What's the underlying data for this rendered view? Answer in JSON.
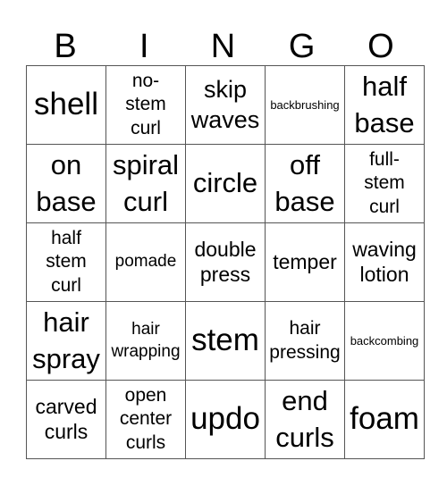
{
  "header": [
    "B",
    "I",
    "N",
    "G",
    "O"
  ],
  "cells": [
    [
      "shell",
      "no-\nstem\ncurl",
      "skip\nwaves",
      "backbrushing",
      "half\nbase"
    ],
    [
      "on\nbase",
      "spiral\ncurl",
      "circle",
      "off\nbase",
      "full-\nstem\ncurl"
    ],
    [
      "half\nstem\ncurl",
      "pomade",
      "double\npress",
      "temper",
      "waving\nlotion"
    ],
    [
      "hair\nspray",
      "hair\nwrapping",
      "stem",
      "hair\npressing",
      "backcombing"
    ],
    [
      "carved\ncurls",
      "open\ncenter\ncurls",
      "updo",
      "end\ncurls",
      "foam"
    ]
  ]
}
